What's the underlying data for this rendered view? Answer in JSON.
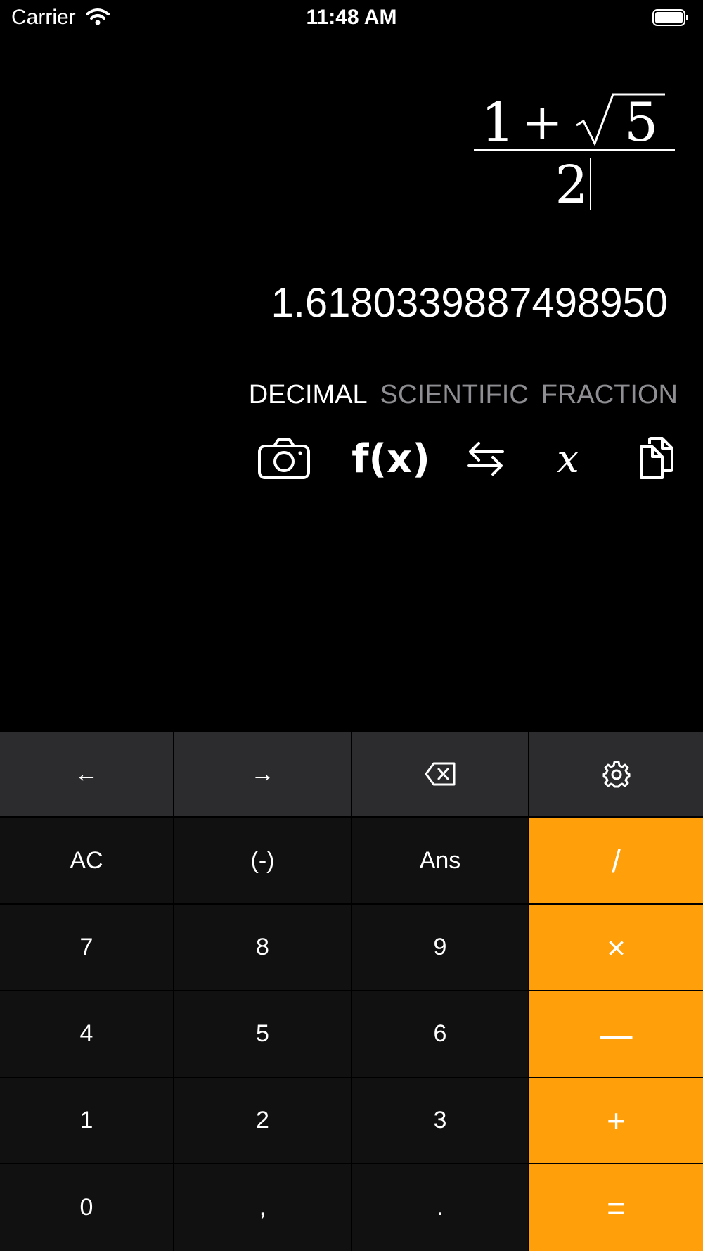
{
  "status": {
    "carrier": "Carrier",
    "time": "11:48 AM"
  },
  "expression": {
    "numerator_one": "1",
    "numerator_plus": "+",
    "numerator_radicand": "5",
    "denominator": "2"
  },
  "result": "1.6180339887498950",
  "modes": [
    "DECIMAL",
    "SCIENTIFIC",
    "FRACTION"
  ],
  "active_mode": "DECIMAL",
  "toolbar": {
    "function_label": "f(x)",
    "variable_label": "x"
  },
  "keys": {
    "row_nav": [
      "←",
      "→"
    ],
    "row1": [
      "AC",
      "(-)",
      "Ans",
      "/"
    ],
    "row2": [
      "7",
      "8",
      "9",
      "×"
    ],
    "row3": [
      "4",
      "5",
      "6",
      "—"
    ],
    "row4": [
      "1",
      "2",
      "3",
      "+"
    ],
    "row5": [
      "0",
      ",",
      ".",
      "="
    ]
  },
  "icons": [
    "wifi-icon",
    "battery-icon",
    "camera-icon",
    "swap-arrows-icon",
    "copy-icon",
    "backspace-icon",
    "gear-icon"
  ],
  "colors": {
    "operator_key": "#ff9f0a",
    "top_row_key": "#2c2c2e",
    "number_key": "#111111",
    "inactive_mode": "#8e8e93"
  }
}
